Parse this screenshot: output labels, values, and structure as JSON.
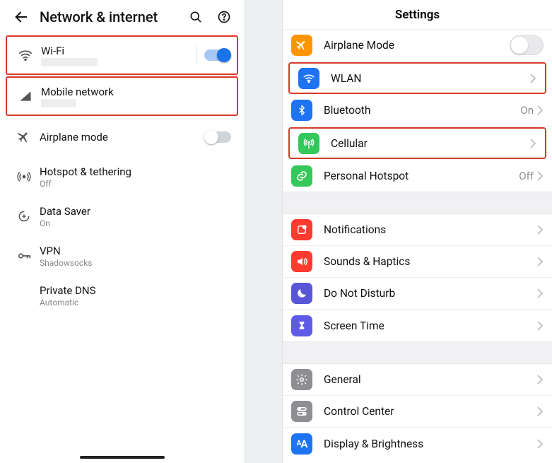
{
  "left": {
    "title": "Network & internet",
    "items": [
      {
        "id": "wifi",
        "label": "Wi-Fi",
        "sub_redacted": true,
        "toggle": "on",
        "highlight": true
      },
      {
        "id": "mobile",
        "label": "Mobile network",
        "sub_redacted": true,
        "highlight": true
      },
      {
        "id": "airplane",
        "label": "Airplane mode",
        "toggle": "off"
      },
      {
        "id": "hotspot",
        "label": "Hotspot & tethering",
        "sub": "Off"
      },
      {
        "id": "datasaver",
        "label": "Data Saver",
        "sub": "On"
      },
      {
        "id": "vpn",
        "label": "VPN",
        "sub": "Shadowsocks"
      },
      {
        "id": "pdns",
        "label": "Private DNS",
        "sub": "Automatic"
      }
    ]
  },
  "right": {
    "title": "Settings",
    "rows": [
      {
        "id": "airplane",
        "label": "Airplane Mode",
        "color": "c-orange",
        "toggle": "off"
      },
      {
        "id": "wlan",
        "label": "WLAN",
        "color": "c-blue",
        "chevron": true,
        "highlight": true
      },
      {
        "id": "bluetooth",
        "label": "Bluetooth",
        "color": "c-blue",
        "status": "On",
        "chevron": true
      },
      {
        "id": "cellular",
        "label": "Cellular",
        "color": "c-green",
        "chevron": true,
        "highlight": true
      },
      {
        "id": "hotspot",
        "label": "Personal Hotspot",
        "color": "c-green",
        "status": "Off",
        "chevron": true
      },
      {
        "gap": true
      },
      {
        "id": "notif",
        "label": "Notifications",
        "color": "c-red",
        "chevron": true
      },
      {
        "id": "sounds",
        "label": "Sounds & Haptics",
        "color": "c-red",
        "chevron": true
      },
      {
        "id": "dnd",
        "label": "Do Not Disturb",
        "color": "c-purple",
        "chevron": true
      },
      {
        "id": "screentime",
        "label": "Screen Time",
        "color": "c-indigo",
        "chevron": true
      },
      {
        "gap": true
      },
      {
        "id": "general",
        "label": "General",
        "color": "c-gray",
        "chevron": true
      },
      {
        "id": "control",
        "label": "Control Center",
        "color": "c-gray",
        "chevron": true
      },
      {
        "id": "display",
        "label": "Display & Brightness",
        "color": "c-blue",
        "chevron": true
      }
    ]
  }
}
